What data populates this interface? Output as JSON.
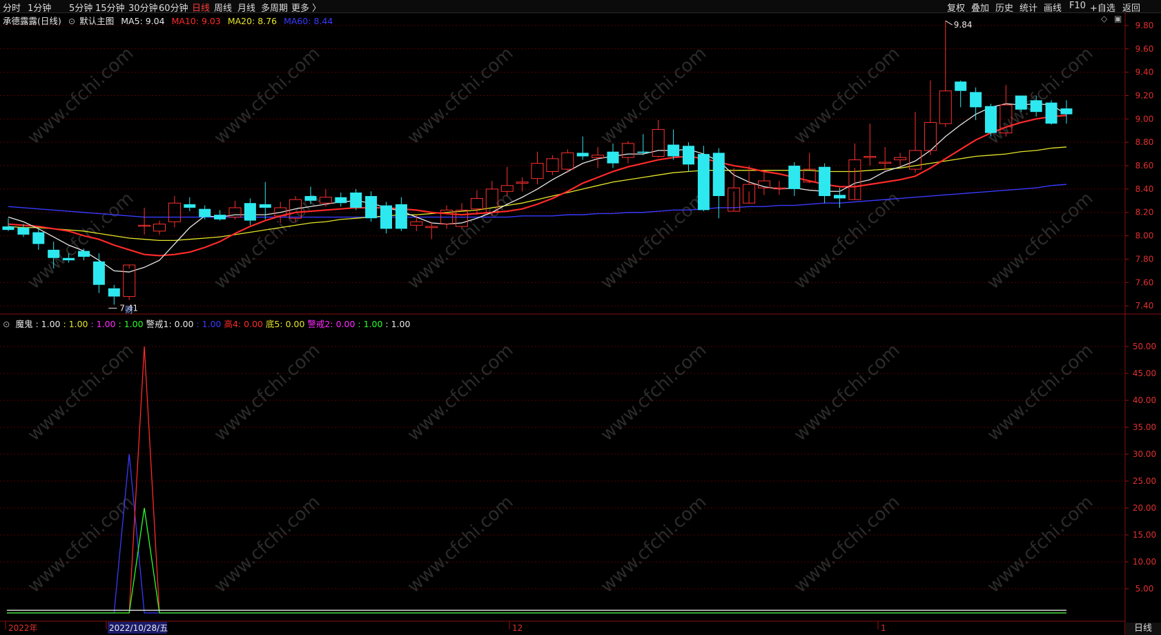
{
  "topbar": {
    "periods": [
      "分时",
      "1分钟",
      "5分钟",
      "15分钟",
      "30分钟",
      "60分钟",
      "日线",
      "周线",
      "月线",
      "多周期",
      "更多 〉"
    ],
    "active": "日线",
    "right_buttons": [
      "复权",
      "叠加",
      "历史",
      "统计",
      "画线",
      "F10",
      "+自选",
      "返回"
    ]
  },
  "main_chart": {
    "title": "承德露露(日线)",
    "template": "默认主图",
    "ma5": {
      "label": "MA5:",
      "value": "9.04",
      "color": "#e8e8e8"
    },
    "ma10": {
      "label": "MA10:",
      "value": "9.03",
      "color": "#ff2a2a"
    },
    "ma20": {
      "label": "MA20:",
      "value": "8.76",
      "color": "#e6e62a"
    },
    "ma60": {
      "label": "MA60:",
      "value": "8.44",
      "color": "#3a3aff"
    },
    "high_label": "9.84",
    "low_label": "7.41",
    "marker": "财",
    "y_ticks": [
      "9.80",
      "9.60",
      "9.40",
      "9.20",
      "9.00",
      "8.80",
      "8.60",
      "8.40",
      "8.20",
      "8.00",
      "7.80",
      "7.60",
      "7.40"
    ],
    "y_range": [
      7.33,
      9.9
    ]
  },
  "indicator": {
    "name": "魔鬼",
    "items": [
      {
        "label": "魔鬼 : ",
        "value": "1.00",
        "color": "#e8e8e8"
      },
      {
        "label": " : ",
        "value": "1.00",
        "color": "#e6e62a"
      },
      {
        "label": " : ",
        "value": "1.00",
        "color": "#ff2aff"
      },
      {
        "label": " : ",
        "value": "1.00",
        "color": "#2aff2a"
      },
      {
        "label": " 警戒1: ",
        "value": "0.00",
        "color": "#e8e8e8"
      },
      {
        "label": " : ",
        "value": "1.00",
        "color": "#3a3aff"
      },
      {
        "label": " 高4: ",
        "value": "0.00",
        "color": "#ff2a2a"
      },
      {
        "label": " 底5: ",
        "value": "0.00",
        "color": "#e6e62a"
      },
      {
        "label": " 警戒2: ",
        "value": "0.00",
        "color": "#ff2aff"
      },
      {
        "label": " : ",
        "value": "1.00",
        "color": "#2aff2a"
      },
      {
        "label": " : ",
        "value": "1.00",
        "color": "#e8e8e8"
      }
    ],
    "y_ticks": [
      "50.00",
      "45.00",
      "40.00",
      "35.00",
      "30.00",
      "25.00",
      "20.00",
      "15.00",
      "10.00",
      "5.00"
    ],
    "y_range": [
      0,
      50
    ]
  },
  "x_axis": {
    "labels": [
      {
        "text": "2022年"
      },
      {
        "text": "2022/10/28/五",
        "highlight": true
      },
      {
        "text": "12"
      },
      {
        "text": "1"
      }
    ]
  },
  "watermark": "www.cfchi.com",
  "period_label": "日线",
  "chart_data": {
    "type": "candlestick",
    "open": [
      8.08,
      8.07,
      8.03,
      7.88,
      7.81,
      7.87,
      7.78,
      7.55,
      7.48,
      8.09,
      8.04,
      8.12,
      8.27,
      8.23,
      8.18,
      8.16,
      8.28,
      8.27,
      8.17,
      8.15,
      8.34,
      8.28,
      8.33,
      8.37,
      8.34,
      8.26,
      8.27,
      8.09,
      8.07,
      8.1,
      8.08,
      8.23,
      8.2,
      8.38,
      8.45,
      8.49,
      8.55,
      8.57,
      8.71,
      8.67,
      8.72,
      8.67,
      8.72,
      8.68,
      8.78,
      8.77,
      8.7,
      8.71,
      8.21,
      8.28,
      8.41,
      8.41,
      8.6,
      8.46,
      8.59,
      8.35,
      8.31,
      8.67,
      8.62,
      8.65,
      8.57,
      8.73,
      8.96,
      9.32,
      9.23,
      9.11,
      8.88,
      9.2,
      9.16,
      9.14,
      9.09
    ],
    "close": [
      8.05,
      8.01,
      7.93,
      7.81,
      7.79,
      7.82,
      7.58,
      7.48,
      7.75,
      8.09,
      8.1,
      8.28,
      8.24,
      8.16,
      8.14,
      8.24,
      8.13,
      8.24,
      8.24,
      8.31,
      8.3,
      8.33,
      8.28,
      8.24,
      8.15,
      8.06,
      8.06,
      8.12,
      8.08,
      8.22,
      8.22,
      8.32,
      8.4,
      8.43,
      8.46,
      8.62,
      8.66,
      8.71,
      8.68,
      8.69,
      8.62,
      8.79,
      8.71,
      8.91,
      8.68,
      8.61,
      8.22,
      8.34,
      8.41,
      8.44,
      8.47,
      8.41,
      8.4,
      8.57,
      8.34,
      8.32,
      8.65,
      8.68,
      8.63,
      8.67,
      8.73,
      8.97,
      9.24,
      9.24,
      9.1,
      8.88,
      9.12,
      9.08,
      9.06,
      8.96,
      9.04
    ],
    "high": [
      8.15,
      8.1,
      8.06,
      7.95,
      7.85,
      7.89,
      7.85,
      7.58,
      7.72,
      8.24,
      8.13,
      8.34,
      8.33,
      8.26,
      8.22,
      8.3,
      8.32,
      8.46,
      8.29,
      8.34,
      8.42,
      8.4,
      8.37,
      8.4,
      8.38,
      8.29,
      8.33,
      8.18,
      8.12,
      8.26,
      8.28,
      8.39,
      8.47,
      8.59,
      8.5,
      8.72,
      8.69,
      8.74,
      8.85,
      8.76,
      8.79,
      8.81,
      8.87,
      8.99,
      8.91,
      8.8,
      8.77,
      8.75,
      8.58,
      8.6,
      8.56,
      8.47,
      8.63,
      8.71,
      8.62,
      8.41,
      8.79,
      8.96,
      8.76,
      8.71,
      9.06,
      9.33,
      9.84,
      9.33,
      9.27,
      9.13,
      9.29,
      9.2,
      9.2,
      9.16,
      9.16
    ],
    "low": [
      8.04,
      7.99,
      7.88,
      7.72,
      7.77,
      7.79,
      7.51,
      7.41,
      7.45,
      8.01,
      8.01,
      8.07,
      8.21,
      8.14,
      8.13,
      8.14,
      8.09,
      8.14,
      8.11,
      8.12,
      8.27,
      8.25,
      8.25,
      8.22,
      8.12,
      8.02,
      8.04,
      8.04,
      7.97,
      8.06,
      8.06,
      8.18,
      8.17,
      8.34,
      8.38,
      8.44,
      8.52,
      8.54,
      8.65,
      8.58,
      8.58,
      8.62,
      8.69,
      8.67,
      8.65,
      8.55,
      8.21,
      8.15,
      8.38,
      8.38,
      8.35,
      8.35,
      8.34,
      8.45,
      8.28,
      8.24,
      8.58,
      8.6,
      8.56,
      8.6,
      8.54,
      8.69,
      8.93,
      9.1,
      8.99,
      8.85,
      8.85,
      9.06,
      9.02,
      8.95,
      8.96
    ],
    "ma5": [
      8.16,
      8.12,
      8.06,
      7.99,
      7.92,
      7.87,
      7.79,
      7.7,
      7.69,
      7.73,
      7.79,
      7.93,
      8.07,
      8.17,
      8.16,
      8.18,
      8.18,
      8.18,
      8.2,
      8.23,
      8.25,
      8.27,
      8.29,
      8.3,
      8.28,
      8.24,
      8.21,
      8.16,
      8.11,
      8.1,
      8.11,
      8.15,
      8.2,
      8.27,
      8.33,
      8.4,
      8.48,
      8.55,
      8.62,
      8.66,
      8.68,
      8.7,
      8.7,
      8.73,
      8.73,
      8.74,
      8.7,
      8.64,
      8.52,
      8.46,
      8.42,
      8.4,
      8.41,
      8.39,
      8.38,
      8.38,
      8.45,
      8.48,
      8.55,
      8.59,
      8.64,
      8.73,
      8.85,
      8.95,
      9.04,
      9.1,
      9.13,
      9.12,
      9.13,
      9.12,
      9.04
    ],
    "ma10": [
      8.1,
      8.09,
      8.08,
      8.06,
      8.04,
      8.0,
      7.97,
      7.92,
      7.88,
      7.84,
      7.83,
      7.84,
      7.86,
      7.9,
      7.95,
      8.02,
      8.08,
      8.13,
      8.17,
      8.2,
      8.21,
      8.22,
      8.23,
      8.24,
      8.24,
      8.24,
      8.23,
      8.22,
      8.2,
      8.19,
      8.18,
      8.19,
      8.2,
      8.21,
      8.23,
      8.27,
      8.32,
      8.38,
      8.45,
      8.5,
      8.55,
      8.59,
      8.62,
      8.65,
      8.67,
      8.68,
      8.66,
      8.63,
      8.6,
      8.58,
      8.55,
      8.53,
      8.5,
      8.47,
      8.44,
      8.42,
      8.42,
      8.44,
      8.46,
      8.48,
      8.51,
      8.58,
      8.66,
      8.74,
      8.82,
      8.88,
      8.93,
      8.97,
      9.0,
      9.02,
      9.03
    ],
    "ma20": [
      8.08,
      8.07,
      8.07,
      8.06,
      8.05,
      8.04,
      8.02,
      8.0,
      7.98,
      7.97,
      7.96,
      7.96,
      7.97,
      7.98,
      7.99,
      8.01,
      8.03,
      8.05,
      8.07,
      8.09,
      8.11,
      8.12,
      8.14,
      8.15,
      8.16,
      8.17,
      8.18,
      8.18,
      8.19,
      8.2,
      8.21,
      8.22,
      8.24,
      8.26,
      8.28,
      8.31,
      8.34,
      8.37,
      8.4,
      8.43,
      8.46,
      8.48,
      8.5,
      8.52,
      8.54,
      8.55,
      8.56,
      8.56,
      8.56,
      8.56,
      8.56,
      8.56,
      8.56,
      8.56,
      8.55,
      8.55,
      8.55,
      8.56,
      8.57,
      8.58,
      8.6,
      8.62,
      8.64,
      8.66,
      8.68,
      8.69,
      8.7,
      8.72,
      8.73,
      8.75,
      8.76
    ],
    "ma60": [
      8.25,
      8.24,
      8.23,
      8.22,
      8.21,
      8.2,
      8.19,
      8.18,
      8.17,
      8.16,
      8.16,
      8.16,
      8.16,
      8.16,
      8.16,
      8.16,
      8.16,
      8.16,
      8.16,
      8.16,
      8.16,
      8.16,
      8.16,
      8.16,
      8.16,
      8.16,
      8.16,
      8.16,
      8.16,
      8.16,
      8.16,
      8.16,
      8.16,
      8.16,
      8.17,
      8.17,
      8.17,
      8.18,
      8.18,
      8.19,
      8.19,
      8.2,
      8.2,
      8.21,
      8.22,
      8.22,
      8.23,
      8.24,
      8.24,
      8.25,
      8.25,
      8.26,
      8.26,
      8.27,
      8.28,
      8.28,
      8.29,
      8.3,
      8.31,
      8.32,
      8.33,
      8.34,
      8.35,
      8.36,
      8.37,
      8.38,
      8.39,
      8.4,
      8.41,
      8.43,
      8.44
    ],
    "indicator_series": [
      {
        "color": "#3a3aff",
        "peak_index": 8,
        "peak": 30
      },
      {
        "color": "#ff2a2a",
        "peak_index": 9,
        "peak": 50
      },
      {
        "color": "#2aff2a",
        "peak_index": 9,
        "peak": 20
      },
      {
        "color": "#e8e8e8",
        "level": 1
      }
    ]
  }
}
